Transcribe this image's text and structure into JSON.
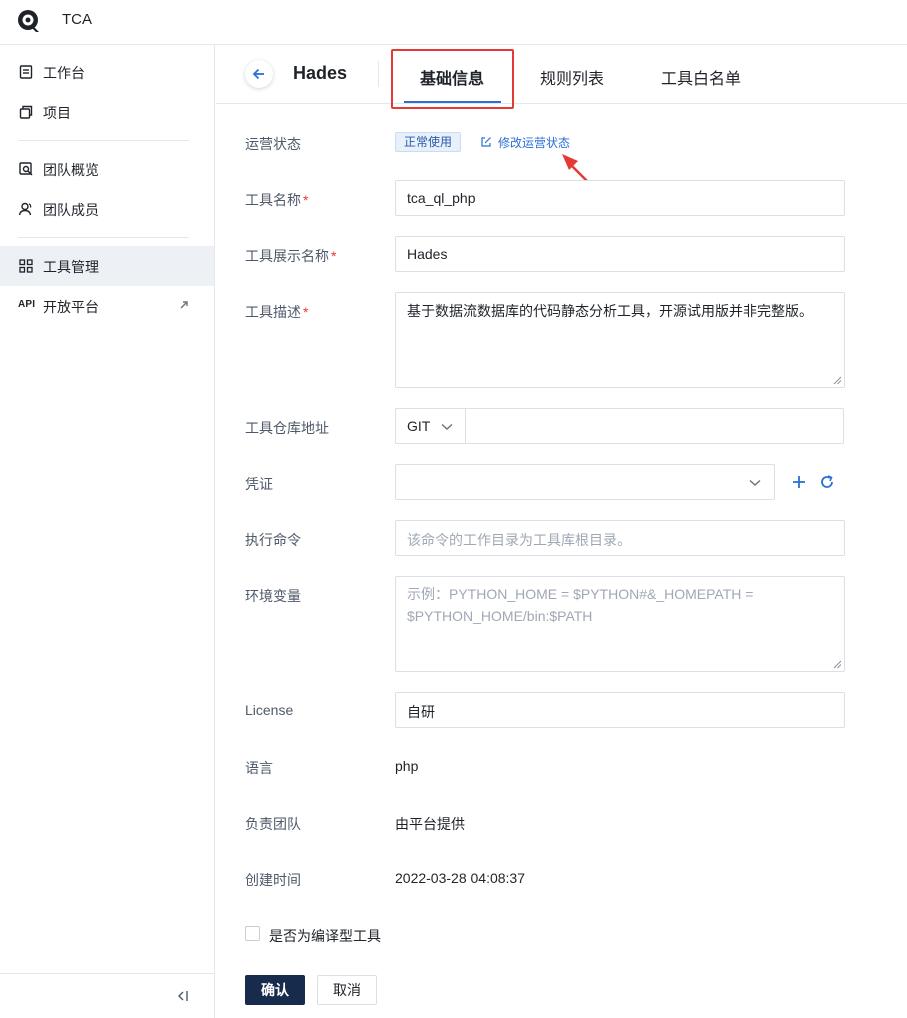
{
  "app": {
    "title": "TCA"
  },
  "sidebar": {
    "items": [
      {
        "label": "工作台",
        "icon": "workbench-icon"
      },
      {
        "label": "项目",
        "icon": "project-icon"
      },
      {
        "label": "团队概览",
        "icon": "team-overview-icon"
      },
      {
        "label": "团队成员",
        "icon": "team-members-icon"
      },
      {
        "label": "工具管理",
        "icon": "tool-management-icon",
        "active": true
      },
      {
        "label": "开放平台",
        "icon": "api-icon",
        "api_text": "API",
        "external": true
      }
    ]
  },
  "header": {
    "tool_name": "Hades",
    "tabs": [
      {
        "label": "基础信息",
        "active": true
      },
      {
        "label": "规则列表"
      },
      {
        "label": "工具白名单"
      }
    ]
  },
  "form": {
    "status": {
      "label": "运营状态",
      "badge": "正常使用",
      "edit_link": "修改运营状态"
    },
    "name": {
      "label": "工具名称",
      "value": "tca_ql_php",
      "required": "*"
    },
    "display_name": {
      "label": "工具展示名称",
      "value": "Hades",
      "required": "*"
    },
    "description": {
      "label": "工具描述",
      "value": "基于数据流数据库的代码静态分析工具，开源试用版并非完整版。",
      "required": "*"
    },
    "repo": {
      "label": "工具仓库地址",
      "scm_type": "GIT",
      "value": ""
    },
    "credential": {
      "label": "凭证",
      "value": ""
    },
    "command": {
      "label": "执行命令",
      "placeholder": "该命令的工作目录为工具库根目录。"
    },
    "env": {
      "label": "环境变量",
      "placeholder": "示例：PYTHON_HOME = $PYTHON#&_HOMEPATH = $PYTHON_HOME/bin:$PATH"
    },
    "license": {
      "label": "License",
      "value": "自研"
    },
    "language": {
      "label": "语言",
      "value": "php"
    },
    "team": {
      "label": "负责团队",
      "value": "由平台提供"
    },
    "created": {
      "label": "创建时间",
      "value": "2022-03-28 04:08:37"
    },
    "compiled": {
      "label": "是否为编译型工具",
      "checked": false
    },
    "confirm_label": "确认",
    "cancel_label": "取消"
  },
  "colors": {
    "primary_button": "#172b4d",
    "link": "#2b6fd6",
    "annotation": "#e53935",
    "active_nav": "#edf0f5"
  }
}
